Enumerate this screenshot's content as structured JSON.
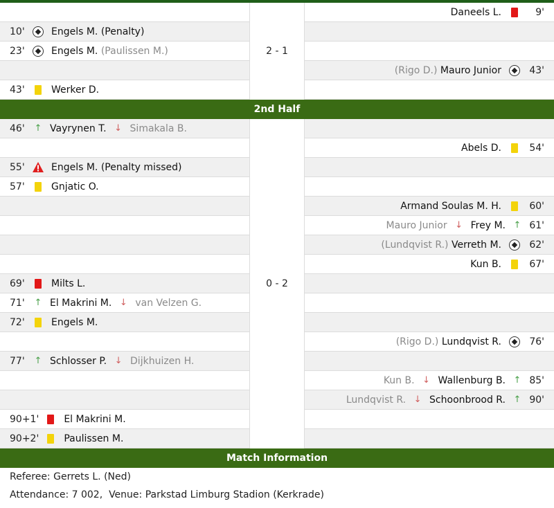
{
  "colors": {
    "header_bar": "#3a6b14",
    "yellow_card": "#f3d30a",
    "red_card": "#e21818",
    "sub_in": "#4aa04a",
    "sub_out": "#d06060"
  },
  "first_half": {
    "score": "2 - 1",
    "rows": [
      {
        "side": "away",
        "minute": "9'",
        "type": "red",
        "player": "Daneels L."
      },
      {
        "side": "home",
        "minute": "10'",
        "type": "goal",
        "player": "Engels M. (Penalty)"
      },
      {
        "side": "home",
        "minute": "23'",
        "type": "goal",
        "player": "Engels M.",
        "assist": "(Paulissen M.)"
      },
      {
        "side": "away",
        "minute": "43'",
        "type": "goal",
        "player": "Mauro Junior",
        "assist": "(Rigo D.)"
      },
      {
        "side": "home",
        "minute": "43'",
        "type": "yellow",
        "player": "Werker D."
      }
    ]
  },
  "second_half": {
    "title": "2nd Half",
    "score": "0 - 2",
    "rows": [
      {
        "side": "home",
        "minute": "46'",
        "type": "sub",
        "in": "Vayrynen T.",
        "out": "Simakala B."
      },
      {
        "side": "away",
        "minute": "54'",
        "type": "yellow",
        "player": "Abels D."
      },
      {
        "side": "home",
        "minute": "55'",
        "type": "missed",
        "player": "Engels M. (Penalty missed)"
      },
      {
        "side": "home",
        "minute": "57'",
        "type": "yellow",
        "player": "Gnjatic O."
      },
      {
        "side": "away",
        "minute": "60'",
        "type": "yellow",
        "player": "Armand Soulas M. H."
      },
      {
        "side": "away",
        "minute": "61'",
        "type": "sub",
        "in": "Frey M.",
        "out": "Mauro Junior"
      },
      {
        "side": "away",
        "minute": "62'",
        "type": "goal",
        "player": "Verreth M.",
        "assist": "(Lundqvist R.)"
      },
      {
        "side": "away",
        "minute": "67'",
        "type": "yellow",
        "player": "Kun B."
      },
      {
        "side": "home",
        "minute": "69'",
        "type": "red",
        "player": "Milts L."
      },
      {
        "side": "home",
        "minute": "71'",
        "type": "sub",
        "in": "El Makrini M.",
        "out": "van Velzen G."
      },
      {
        "side": "home",
        "minute": "72'",
        "type": "yellow",
        "player": "Engels M."
      },
      {
        "side": "away",
        "minute": "76'",
        "type": "goal",
        "player": "Lundqvist R.",
        "assist": "(Rigo D.)"
      },
      {
        "side": "home",
        "minute": "77'",
        "type": "sub",
        "in": "Schlosser P.",
        "out": "Dijkhuizen H."
      },
      {
        "side": "away",
        "minute": "85'",
        "type": "sub",
        "in": "Wallenburg B.",
        "out": "Kun B."
      },
      {
        "side": "away",
        "minute": "90'",
        "type": "sub",
        "in": "Schoonbrood R.",
        "out": "Lundqvist R."
      },
      {
        "side": "home",
        "minute": "90+1'",
        "type": "red",
        "player": "El Makrini M."
      },
      {
        "side": "home",
        "minute": "90+2'",
        "type": "yellow",
        "player": "Paulissen M."
      }
    ]
  },
  "match_info": {
    "title": "Match Information",
    "referee_label": "Referee:",
    "referee": "Gerrets L. (Ned)",
    "attendance_label": "Attendance:",
    "attendance": "7 002,",
    "venue_label": "Venue:",
    "venue": "Parkstad Limburg Stadion (Kerkrade)"
  }
}
